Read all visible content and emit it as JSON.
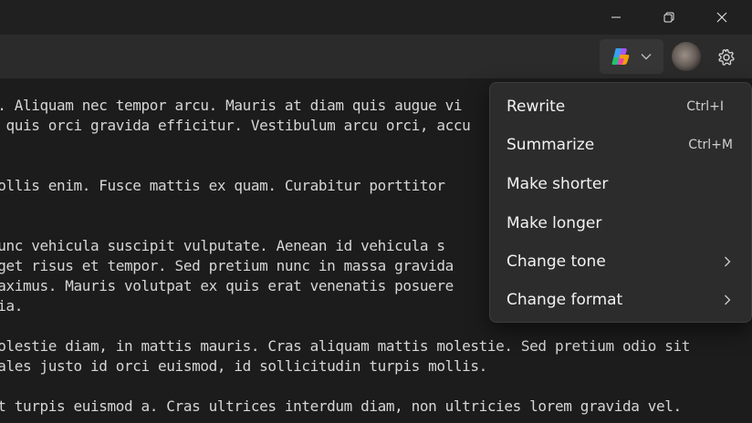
{
  "window": {
    "minimize_icon": "minimize-icon",
    "restore_icon": "restore-icon",
    "close_icon": "close-icon"
  },
  "toolbar": {
    "copilot_icon": "copilot-icon",
    "dropdown_icon": "chevron-down-icon",
    "settings_icon": "gear-icon"
  },
  "editor": {
    "lines": [
      "t. Aliquam nec tempor arcu. Mauris at diam quis augue vi",
      "t quis orci gravida efficitur. Vestibulum arcu orci, accu",
      "",
      "mollis enim. Fusce mattis ex quam. Curabitur porttitor",
      "",
      "Nunc vehicula suscipit vulputate. Aenean id vehicula s",
      "eget risus et tempor. Sed pretium nunc in massa gravida",
      "maximus. Mauris volutpat ex quis erat venenatis posuere",
      "nia.",
      "",
      "molestie diam, in mattis mauris. Cras aliquam mattis molestie. Sed pretium odio sit",
      "dales justo id orci euismod, id sollicitudin turpis mollis.",
      "",
      "at turpis euismod a. Cras ultrices interdum diam, non ultricies lorem gravida vel."
    ]
  },
  "menu": {
    "items": [
      {
        "label": "Rewrite",
        "shortcut": "Ctrl+I"
      },
      {
        "label": "Summarize",
        "shortcut": "Ctrl+M"
      },
      {
        "label": "Make shorter",
        "shortcut": ""
      },
      {
        "label": "Make longer",
        "shortcut": ""
      },
      {
        "label": "Change tone",
        "shortcut": ""
      },
      {
        "label": "Change format",
        "shortcut": ""
      }
    ]
  },
  "colors": {
    "background": "#1c1c1c",
    "toolbar": "#2b2b2b",
    "menu": "#2c2c2c",
    "spellcheck": "#e04646"
  }
}
